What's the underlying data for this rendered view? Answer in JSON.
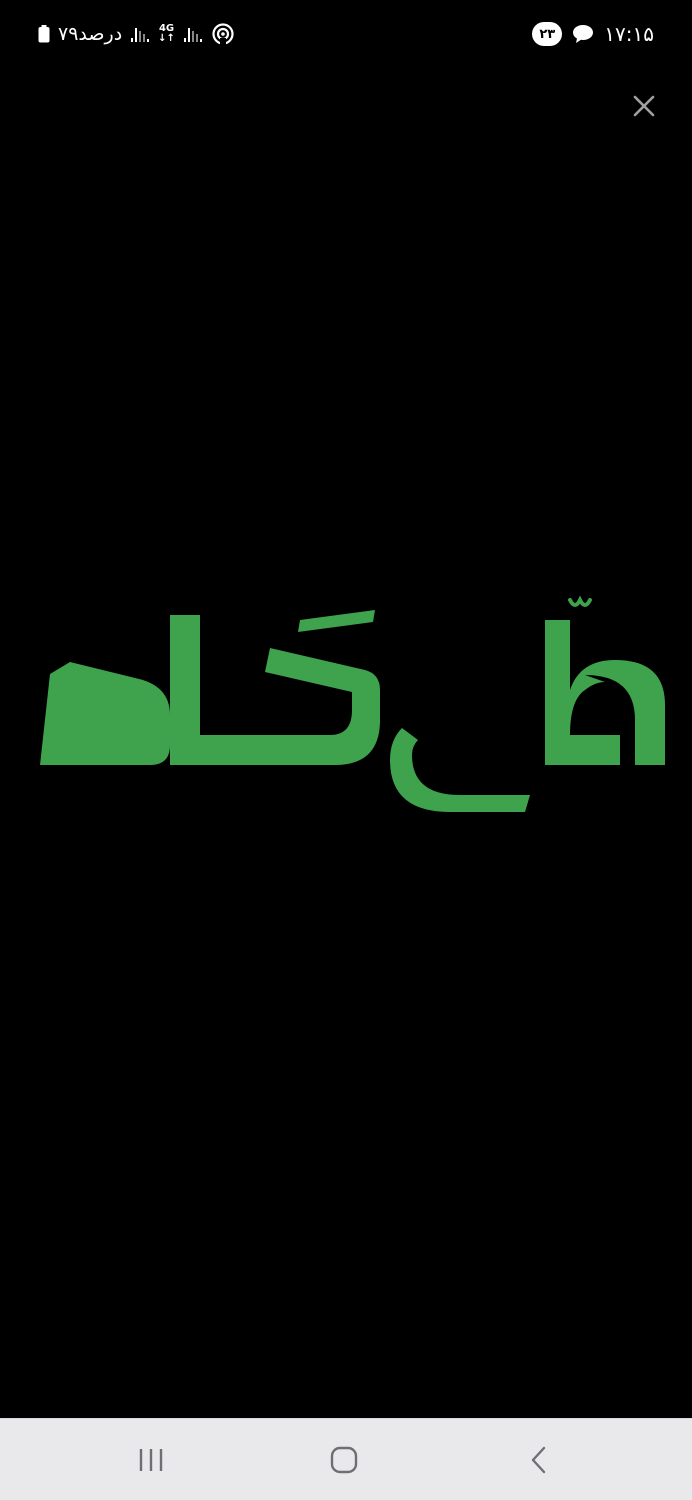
{
  "status_bar": {
    "battery_text": "۷۹درصد",
    "network_type": "4G",
    "notification_count": "۲۳",
    "time": "۱۷:۱۵",
    "icons": [
      "battery-icon",
      "signal-icon",
      "network-icon",
      "hotspot-icon",
      "chat-icon"
    ]
  },
  "logo": {
    "text": "ملّی گلد",
    "color": "#3fa34d"
  },
  "colors": {
    "background": "#000000",
    "nav_bar": "#e9e9ec",
    "nav_icon": "#6e6e73",
    "close_icon": "#a0a0a0"
  },
  "navigation": {
    "icons": [
      "recents-icon",
      "home-icon",
      "back-icon"
    ]
  }
}
